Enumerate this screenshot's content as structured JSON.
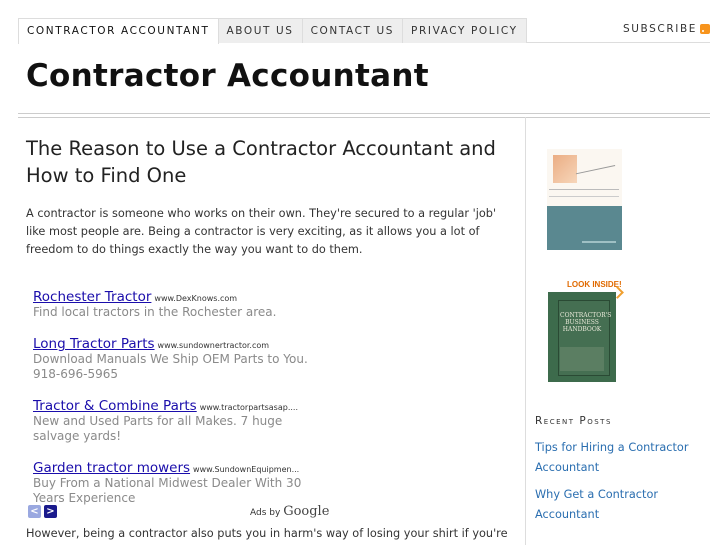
{
  "nav": {
    "tabs": [
      {
        "label": "CONTRACTOR ACCOUNTANT",
        "active": true
      },
      {
        "label": "ABOUT US",
        "active": false
      },
      {
        "label": "CONTACT US",
        "active": false
      },
      {
        "label": "PRIVACY POLICY",
        "active": false
      }
    ],
    "subscribe_label": "SUBSCRIBE"
  },
  "site": {
    "title": "Contractor Accountant"
  },
  "post": {
    "title": "The Reason to Use a Contractor Accountant and How to Find One",
    "intro": "A contractor is someone who works on their own. They're secured to a regular 'job' like most people are. Being a contractor is very exciting, as it allows you a lot of freedom to do things exactly the way you want to do them.",
    "continuation": "However, being a contractor also puts you in harm's way of losing your shirt if you're"
  },
  "ads": {
    "items": [
      {
        "title": "Rochester Tractor",
        "url": "www.DexKnows.com",
        "desc": "Find local tractors in the Rochester area."
      },
      {
        "title": "Long Tractor Parts",
        "url": "www.sundownertractor.com",
        "desc": "Download Manuals We Ship OEM Parts to You. 918-696-5965"
      },
      {
        "title": "Tractor & Combine Parts",
        "url": "www.tractorpartsasap....",
        "desc": "New and Used Parts for all Makes. 7 huge salvage yards!"
      },
      {
        "title": "Garden tractor mowers",
        "url": "www.SundownEquipmen...",
        "desc": "Buy From a National Midwest Dealer With 30 Years Experience"
      }
    ],
    "prev_symbol": "<",
    "next_symbol": ">",
    "ads_by": "Ads by",
    "google": "Google"
  },
  "sidebar": {
    "look_inside": "LOOK INSIDE!",
    "book2_title": "CONTRACTOR'S BUSINESS HANDBOOK",
    "recent_heading": "Recent Posts",
    "recent_posts": [
      "Tips for Hiring a Contractor Accountant",
      "Why Get a Contractor Accountant"
    ]
  },
  "colors": {
    "link": "#2a6eb0",
    "ad_link": "#1a0dab",
    "rss": "#f7941d"
  }
}
